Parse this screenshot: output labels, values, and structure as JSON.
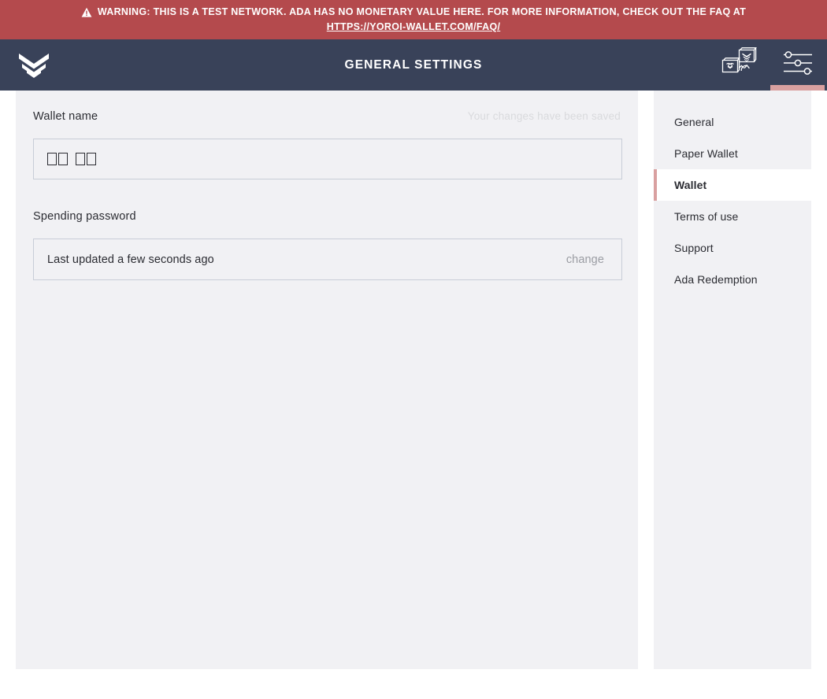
{
  "warning": {
    "icon": "warning-triangle-icon",
    "text": "WARNING: THIS IS A TEST NETWORK. ADA HAS NO MONETARY VALUE HERE. FOR MORE INFORMATION, CHECK OUT THE FAQ AT",
    "link_text": "HTTPS://YOROI-WALLET.COM/FAQ/",
    "background_color": "#b44a4d",
    "text_color": "#ffffff"
  },
  "topbar": {
    "logo_name": "yoroi-logo-icon",
    "title": "GENERAL SETTINGS",
    "background_color": "#394259",
    "actions": [
      {
        "name": "switch-wallet-icon",
        "label": "Switch wallet",
        "active": false
      },
      {
        "name": "settings-sliders-icon",
        "label": "Settings",
        "active": true
      }
    ],
    "active_indicator_color": "#d9a0a0"
  },
  "main": {
    "wallet_name": {
      "label": "Wallet name",
      "value_glyphs": 4,
      "saved_message": "Your changes have been saved"
    },
    "spending_password": {
      "label": "Spending password",
      "status": "Last updated a few seconds ago",
      "change_label": "change"
    }
  },
  "sidebar": {
    "items": [
      {
        "label": "General",
        "active": false
      },
      {
        "label": "Paper Wallet",
        "active": false
      },
      {
        "label": "Wallet",
        "active": true
      },
      {
        "label": "Terms of use",
        "active": false
      },
      {
        "label": "Support",
        "active": false
      },
      {
        "label": "Ada Redemption",
        "active": false
      }
    ],
    "active_accent_color": "#d9a0a0"
  }
}
